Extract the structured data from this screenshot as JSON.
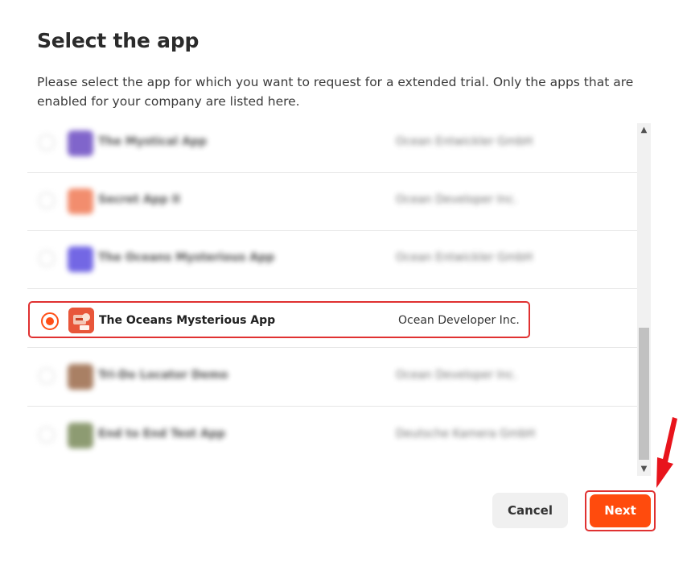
{
  "dialog": {
    "title": "Select the app",
    "description": "Please select the app for which you want to request for a extended trial. Only the apps that are enabled for your company are listed here."
  },
  "apps": [
    {
      "name": "The Mystical App",
      "company": "Ocean Entwickler GmbH",
      "icon_color": "#6b4bc2",
      "selected": false
    },
    {
      "name": "Secret App II",
      "company": "Ocean Developer Inc.",
      "icon_color": "#f07a55",
      "selected": false
    },
    {
      "name": "The Oceans Mysterious App",
      "company": "Ocean Entwickler GmbH",
      "icon_color": "#5b4de0",
      "selected": false
    },
    {
      "name": "The Oceans Mysterious App",
      "company": "Ocean Developer Inc.",
      "icon_color": "#e8563a",
      "selected": true
    },
    {
      "name": "Tri-Do Locator Demo",
      "company": "Ocean Developer Inc.",
      "icon_color": "#9b6a4a",
      "selected": false
    },
    {
      "name": "End to End Test App",
      "company": "Deutsche Kamera GmbH",
      "icon_color": "#7a8a5a",
      "selected": false
    }
  ],
  "buttons": {
    "cancel": "Cancel",
    "next": "Next"
  },
  "colors": {
    "accent": "#ff4b0d",
    "highlight_outline": "#e03131"
  }
}
